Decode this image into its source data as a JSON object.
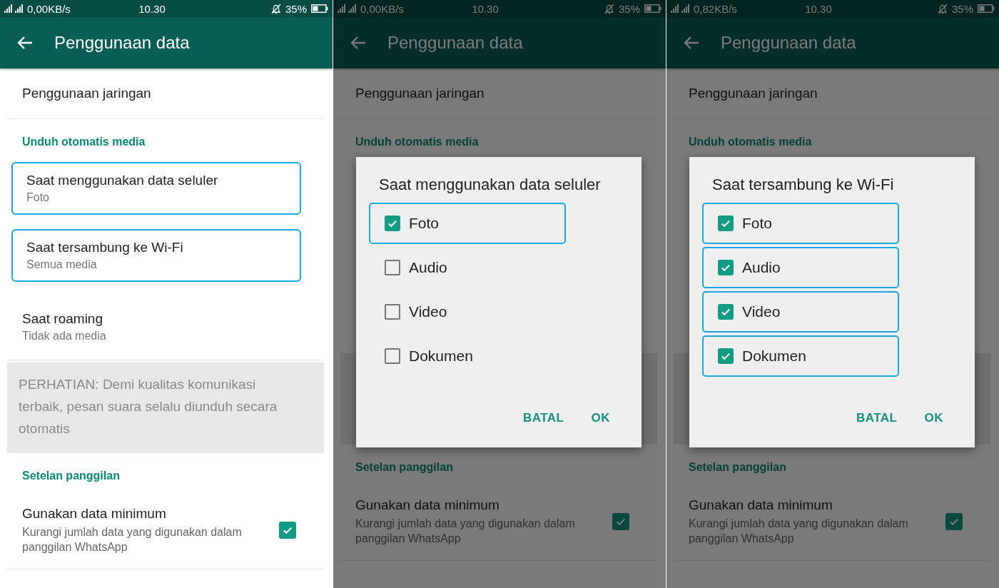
{
  "screens": [
    {
      "status": {
        "speed": "0,00KB/s",
        "time": "10.30",
        "battery": "35%"
      },
      "appbar": {
        "title": "Penggunaan data"
      },
      "dimmed": false,
      "list": [
        {
          "kind": "row",
          "title": "Penggunaan jaringan",
          "highlighted": false
        },
        {
          "kind": "header",
          "title": "Unduh otomatis media"
        },
        {
          "kind": "row",
          "title": "Saat menggunakan data seluler",
          "subtitle": "Foto",
          "highlighted": true
        },
        {
          "kind": "row",
          "title": "Saat tersambung ke Wi-Fi",
          "subtitle": "Semua media",
          "highlighted": true
        },
        {
          "kind": "row",
          "title": "Saat roaming",
          "subtitle": "Tidak ada media",
          "highlighted": false
        },
        {
          "kind": "note",
          "text": "PERHATIAN: Demi kualitas komunikasi terbaik, pesan suara selalu diunduh secara otomatis"
        },
        {
          "kind": "header",
          "title": "Setelan panggilan"
        },
        {
          "kind": "toggle",
          "title": "Gunakan data minimum",
          "subtitle": "Kurangi jumlah data yang digunakan dalam panggilan WhatsApp",
          "checked": true
        }
      ]
    },
    {
      "status": {
        "speed": "0,00KB/s",
        "time": "10.30",
        "battery": "35%"
      },
      "appbar": {
        "title": "Penggunaan data"
      },
      "dimmed": true,
      "list": [
        {
          "kind": "row",
          "title": "Penggunaan jaringan",
          "highlighted": false
        },
        {
          "kind": "header",
          "title": "Unduh otomatis media"
        },
        {
          "kind": "covered"
        },
        {
          "kind": "header",
          "title": "Setelan panggilan"
        },
        {
          "kind": "toggle",
          "title": "Gunakan data minimum",
          "subtitle": "Kurangi jumlah data yang digunakan dalam panggilan WhatsApp",
          "checked": true
        }
      ],
      "dialog": {
        "title": "Saat menggunakan data seluler",
        "options": [
          {
            "label": "Foto",
            "checked": true,
            "highlighted": true
          },
          {
            "label": "Audio",
            "checked": false,
            "highlighted": false
          },
          {
            "label": "Video",
            "checked": false,
            "highlighted": false
          },
          {
            "label": "Dokumen",
            "checked": false,
            "highlighted": false
          }
        ],
        "buttons": [
          "BATAL",
          "OK"
        ]
      }
    },
    {
      "status": {
        "speed": "0,82KB/s",
        "time": "10.30",
        "battery": "35%"
      },
      "appbar": {
        "title": "Penggunaan data"
      },
      "dimmed": true,
      "list": [
        {
          "kind": "row",
          "title": "Penggunaan jaringan",
          "highlighted": false
        },
        {
          "kind": "header",
          "title": "Unduh otomatis media"
        },
        {
          "kind": "covered"
        },
        {
          "kind": "header",
          "title": "Setelan panggilan"
        },
        {
          "kind": "toggle",
          "title": "Gunakan data minimum",
          "subtitle": "Kurangi jumlah data yang digunakan dalam panggilan WhatsApp",
          "checked": true
        }
      ],
      "dialog": {
        "title": "Saat tersambung ke Wi-Fi",
        "options": [
          {
            "label": "Foto",
            "checked": true,
            "highlighted": true
          },
          {
            "label": "Audio",
            "checked": true,
            "highlighted": true
          },
          {
            "label": "Video",
            "checked": true,
            "highlighted": true
          },
          {
            "label": "Dokumen",
            "checked": true,
            "highlighted": true
          }
        ],
        "buttons": [
          "BATAL",
          "OK"
        ]
      }
    }
  ]
}
